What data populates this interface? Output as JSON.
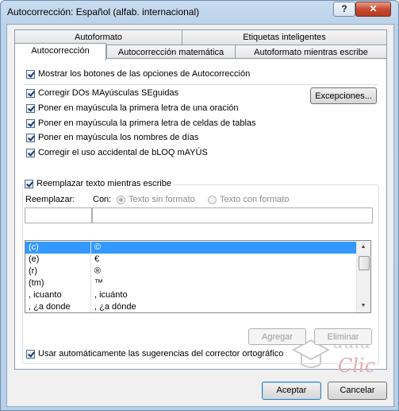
{
  "window": {
    "title": "Autocorrección: Español (alfab. internacional)",
    "help_label": "?",
    "close_label": "✕"
  },
  "tabs_top": [
    {
      "label": "Autoformato"
    },
    {
      "label": "Etiquetas inteligentes"
    }
  ],
  "tabs_bottom": [
    {
      "label": "Autocorrección",
      "active": true
    },
    {
      "label": "Autocorrección matemática",
      "active": false
    },
    {
      "label": "Autoformato mientras escribe",
      "active": false
    }
  ],
  "options": {
    "show_buttons": {
      "label": "Mostrar los botones de las opciones de Autocorrección",
      "checked": true
    },
    "items": [
      {
        "label": "Corregir DOs MAyúsculas SEguidas",
        "checked": true
      },
      {
        "label": "Poner en mayúscula la primera letra de una oración",
        "checked": true
      },
      {
        "label": "Poner en mayúscula la primera letra de celdas de tablas",
        "checked": true
      },
      {
        "label": "Poner en mayúscula los nombres de días",
        "checked": true
      },
      {
        "label": "Corregir el uso accidental de bLOQ mAYÚS",
        "checked": true
      }
    ],
    "exceptions_button": "Excepciones..."
  },
  "replace": {
    "checkbox_label": "Reemplazar texto mientras escribe",
    "checked": true,
    "replace_label": "Reemplazar:",
    "with_label": "Con:",
    "radio_plain": "Texto sin formato",
    "radio_formatted": "Texto con formato",
    "replace_value": "",
    "with_value": "",
    "entries": [
      {
        "from": "(c)",
        "to": "©",
        "selected": true
      },
      {
        "from": "(e)",
        "to": "€",
        "selected": false
      },
      {
        "from": "(r)",
        "to": "®",
        "selected": false
      },
      {
        "from": "(tm)",
        "to": "™",
        "selected": false
      },
      {
        "from": ", icuanto",
        "to": ", icuánto",
        "selected": false
      },
      {
        "from": ", ¿a donde",
        "to": ", ¿a dónde",
        "selected": false
      }
    ],
    "add_button": "Agregar",
    "delete_button": "Eliminar",
    "spelling_checkbox": "Usar automáticamente las sugerencias del corrector ortográfico",
    "spelling_checked": true
  },
  "footer": {
    "ok_button": "Aceptar",
    "cancel_button": "Cancelar"
  },
  "watermark": {
    "line1": "aula",
    "line2": "Clic"
  },
  "colors": {
    "selection": "#3399ff",
    "title_bar": "#bcd2ea"
  }
}
